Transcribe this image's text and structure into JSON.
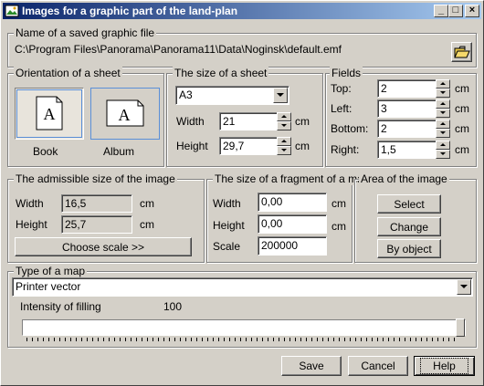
{
  "window": {
    "title": "Images for a graphic part of the land-plan",
    "min_label": "_",
    "max_label": "□",
    "close_label": "×"
  },
  "file": {
    "legend": "Name of a saved graphic file",
    "path": "C:\\Program Files\\Panorama\\Panorama11\\Data\\Noginsk\\default.emf"
  },
  "orientation": {
    "legend": "Orientation of a sheet",
    "book_label": "Book",
    "album_label": "Album",
    "selected": "Book",
    "glyph": "A"
  },
  "sheet_size": {
    "legend": "The size of a sheet",
    "format": "A3",
    "width_label": "Width",
    "width_value": "21",
    "height_label": "Height",
    "height_value": "29,7",
    "unit": "cm"
  },
  "fields": {
    "legend": "Fields",
    "top_label": "Top:",
    "top_value": "2",
    "left_label": "Left:",
    "left_value": "3",
    "bottom_label": "Bottom:",
    "bottom_value": "2",
    "right_label": "Right:",
    "right_value": "1,5",
    "unit": "cm"
  },
  "admissible": {
    "legend": "The admissible size of the image",
    "width_label": "Width",
    "width_value": "16,5",
    "height_label": "Height",
    "height_value": "25,7",
    "unit": "cm",
    "choose_scale_label": "Choose scale >>"
  },
  "fragment": {
    "legend": "The size of a fragment of a map",
    "width_label": "Width",
    "width_value": "0,00",
    "height_label": "Height",
    "height_value": "0,00",
    "scale_label": "Scale",
    "scale_value": "200000",
    "unit": "cm"
  },
  "area": {
    "legend": "Area of the image",
    "select_label": "Select",
    "change_label": "Change",
    "by_object_label": "By object"
  },
  "map_type": {
    "legend": "Type of a map",
    "value": "Printer vector",
    "intensity_label": "Intensity of filling",
    "intensity_value": "100",
    "intensity_fraction": 1.0
  },
  "buttons": {
    "save_label": "Save",
    "cancel_label": "Cancel",
    "help_label": "Help"
  }
}
